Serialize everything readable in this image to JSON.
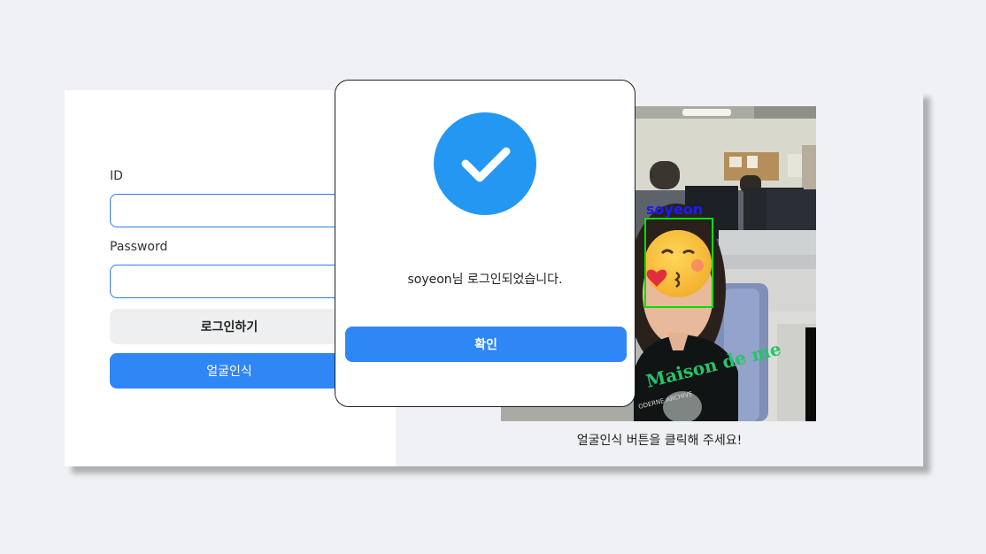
{
  "login_form": {
    "id_label": "ID",
    "id_value": "",
    "password_label": "Password",
    "password_value": "",
    "login_button": "로그인하기",
    "face_button": "얼굴인식"
  },
  "camera": {
    "detected_name": "soyeon",
    "caption": "얼굴인식 버튼을 클릭해 주세요!"
  },
  "modal": {
    "message": "soyeon님 로그인되었습니다.",
    "confirm_button": "확인"
  },
  "colors": {
    "accent": "#2f86f5",
    "check_circle": "#2497f3",
    "face_box": "#00e000",
    "name_label": "#1a1aff"
  }
}
